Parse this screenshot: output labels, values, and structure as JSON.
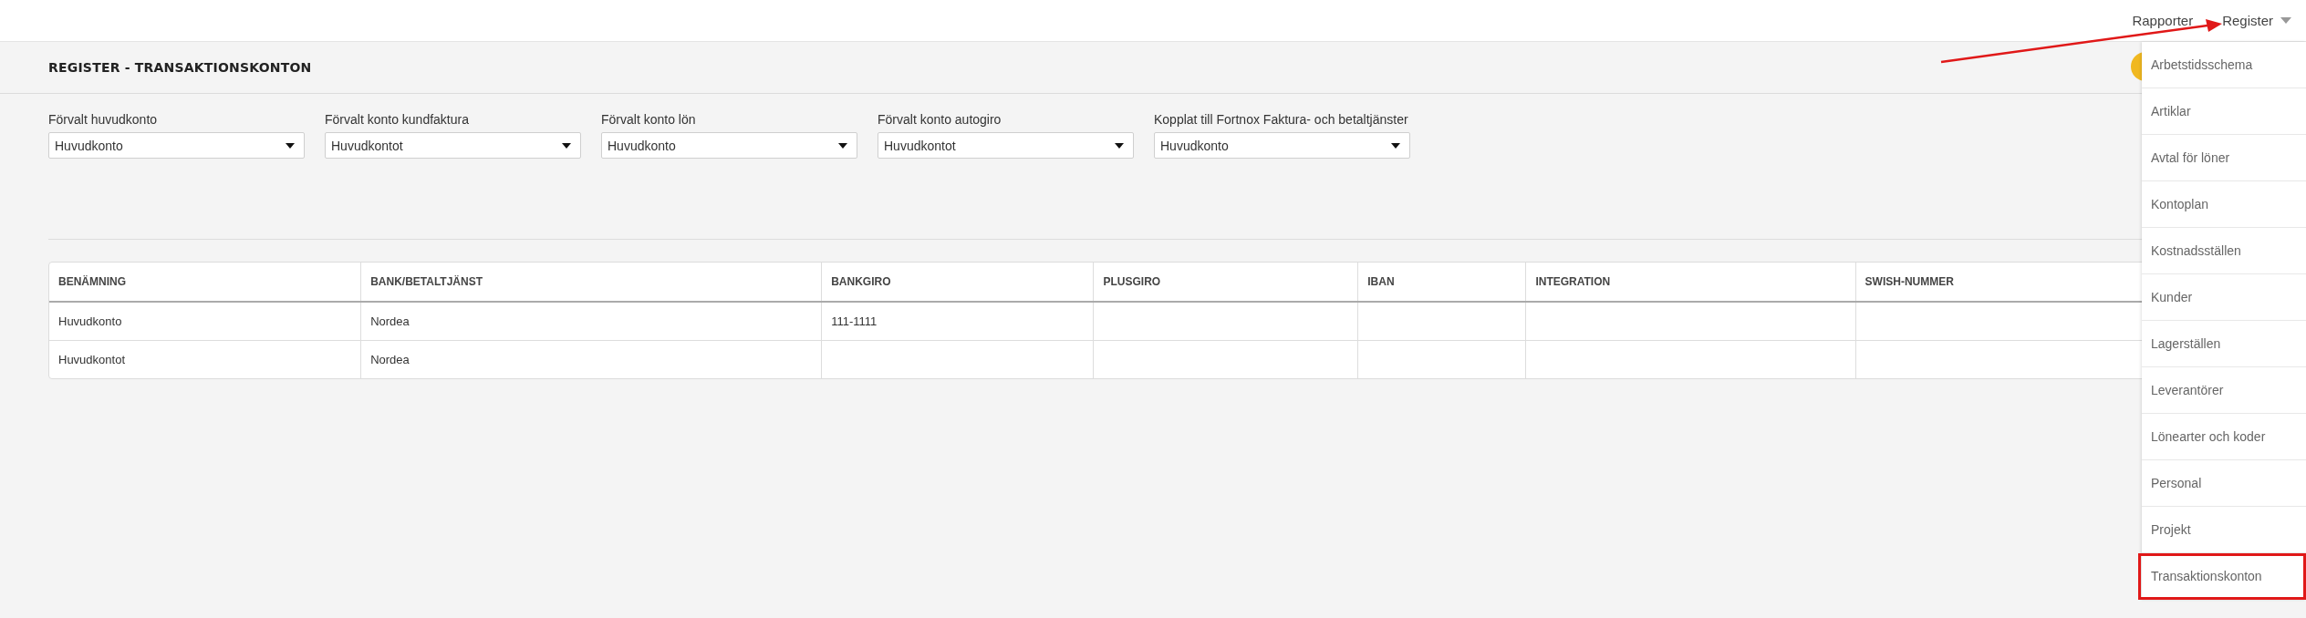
{
  "top_nav": [
    {
      "label": "Rapporter",
      "has_caret": false
    },
    {
      "label": "Register",
      "has_caret": true
    }
  ],
  "page_title": "REGISTER - TRANSAKTIONSKONTON",
  "dropdowns": [
    {
      "label": "Förvalt huvudkonto",
      "value": "Huvudkonto"
    },
    {
      "label": "Förvalt konto kundfaktura",
      "value": "Huvudkontot"
    },
    {
      "label": "Förvalt konto lön",
      "value": "Huvudkonto"
    },
    {
      "label": "Förvalt konto autogiro",
      "value": "Huvudkontot"
    },
    {
      "label": "Kopplat till Fortnox Faktura- och betaltjänster",
      "value": "Huvudkonto"
    }
  ],
  "table": {
    "columns": [
      "BENÄMNING",
      "BANK/BETALTJÄNST",
      "BANKGIRO",
      "PLUSGIRO",
      "IBAN",
      "INTEGRATION",
      "SWISH-NUMMER"
    ],
    "rows": [
      [
        "Huvudkonto",
        "Nordea",
        "111-1111",
        "",
        "",
        "",
        ""
      ],
      [
        "Huvudkontot",
        "Nordea",
        "",
        "",
        "",
        "",
        ""
      ]
    ]
  },
  "register_menu": {
    "items": [
      {
        "label": "Arbetstidsschema",
        "highlighted": false
      },
      {
        "label": "Artiklar",
        "highlighted": false
      },
      {
        "label": "Avtal för löner",
        "highlighted": false
      },
      {
        "label": "Kontoplan",
        "highlighted": false
      },
      {
        "label": "Kostnadsställen",
        "highlighted": false
      },
      {
        "label": "Kunder",
        "highlighted": false
      },
      {
        "label": "Lagerställen",
        "highlighted": false
      },
      {
        "label": "Leverantörer",
        "highlighted": false
      },
      {
        "label": "Lönearter och koder",
        "highlighted": false
      },
      {
        "label": "Personal",
        "highlighted": false
      },
      {
        "label": "Projekt",
        "highlighted": false
      },
      {
        "label": "Transaktionskonton",
        "highlighted": true
      }
    ]
  }
}
